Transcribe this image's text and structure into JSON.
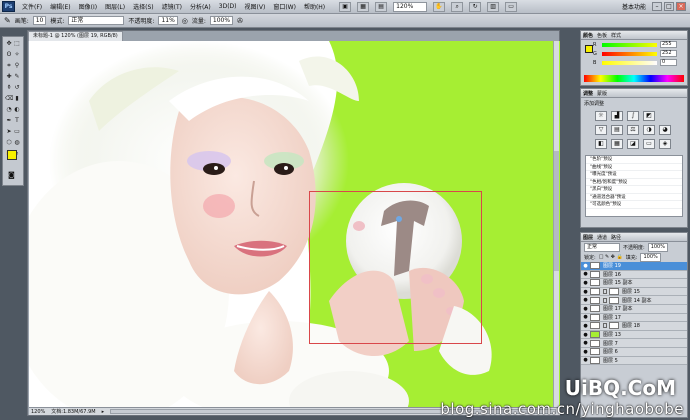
{
  "app": {
    "logo": "Ps"
  },
  "menubar": {
    "items": [
      "文件(F)",
      "编辑(E)",
      "图像(I)",
      "图层(L)",
      "选择(S)",
      "滤镜(T)",
      "分析(A)",
      "3D(D)",
      "视图(V)",
      "窗口(W)",
      "帮助(H)"
    ],
    "zoom": "120%",
    "workspace": "基本功能"
  },
  "options": {
    "brush_label": "画笔:",
    "brush_size": "10",
    "mode_label": "模式:",
    "mode_value": "正常",
    "opacity_label": "不透明度:",
    "opacity_value": "11%",
    "flow_label": "流量:",
    "flow_value": "100%"
  },
  "document": {
    "tab_title": "未标题-1 @ 120% (图层 19, RGB/8)",
    "status_zoom": "120%",
    "status_doc": "文档:1.83M/67.9M"
  },
  "color_panel": {
    "tabs": [
      "颜色",
      "色板",
      "样式"
    ],
    "R": "255",
    "G": "252",
    "B": "0"
  },
  "adjustments_panel": {
    "tabs": [
      "调整",
      "蒙版"
    ],
    "title": "添加调整",
    "presets": [
      "\"色阶\"预设",
      "\"曲线\"预设",
      "\"曝光度\"预设",
      "\"色相/饱和度\"预设",
      "\"黑白\"预设",
      "\"通道混合器\"预设",
      "\"可选颜色\"预设"
    ]
  },
  "layers_panel": {
    "tabs": [
      "图层",
      "通道",
      "路径"
    ],
    "blend_mode": "正常",
    "opacity_label": "不透明度:",
    "opacity_value": "100%",
    "lock_label": "锁定:",
    "fill_label": "填充:",
    "fill_value": "100%",
    "layers": [
      {
        "name": "图层 19"
      },
      {
        "name": "图层 16"
      },
      {
        "name": "图层 15 副本"
      },
      {
        "name": "图层 15"
      },
      {
        "name": "图层 14 副本"
      },
      {
        "name": "图层 17 副本"
      },
      {
        "name": "图层 17"
      },
      {
        "name": "图层 18"
      },
      {
        "name": "图层 13"
      },
      {
        "name": "图层 7"
      },
      {
        "name": "图层 6"
      },
      {
        "name": "图层 5"
      }
    ]
  },
  "watermark": {
    "logo": "UiBQ.CoM",
    "url": "blog.sina.com.cn/yinghaobobe"
  },
  "colors": {
    "canvas_bg": "#a6ee33",
    "foreground": "#f7f000",
    "selection": "#d9474a",
    "layer_selected": "#4a8fd8"
  },
  "icons": [
    "photoshop-logo",
    "brush-icon",
    "eye-icon",
    "layer-mask-icon",
    "adjustment-icons"
  ]
}
